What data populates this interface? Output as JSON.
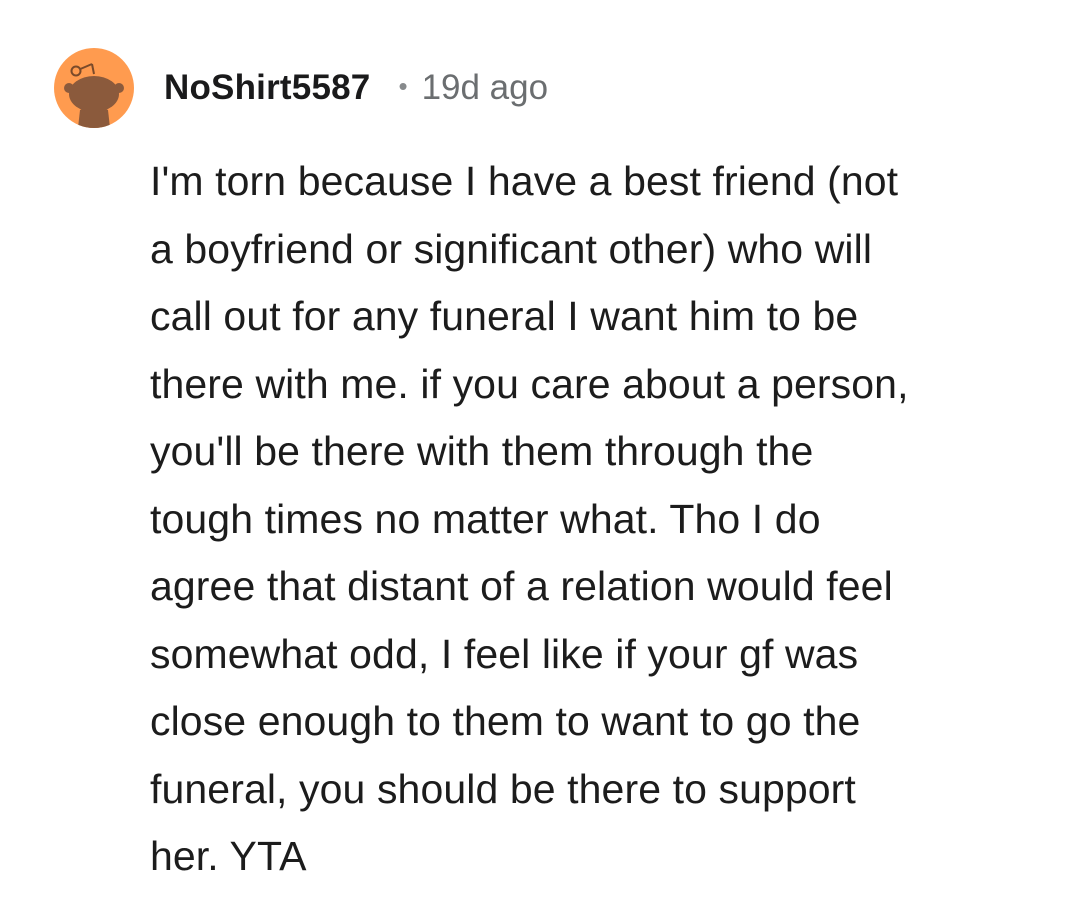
{
  "comment": {
    "author": {
      "username": "NoShirt5587",
      "avatar_icon": "snoo-avatar-icon",
      "avatar_color": "#ff9b4f"
    },
    "separator": "•",
    "timestamp": "19d ago",
    "body": "I'm torn because I have a best friend (not\na boyfriend or significant other) who will\ncall out for any funeral I want him to be\nthere with me. if you care about a person,\nyou'll be there with them through the\ntough times no matter what. Tho I do\nagree that distant of a relation would feel\nsomewhat odd, I feel like if your gf was\nclose enough to them to want to go the\nfuneral, you should be there to support\nher. YTA"
  }
}
